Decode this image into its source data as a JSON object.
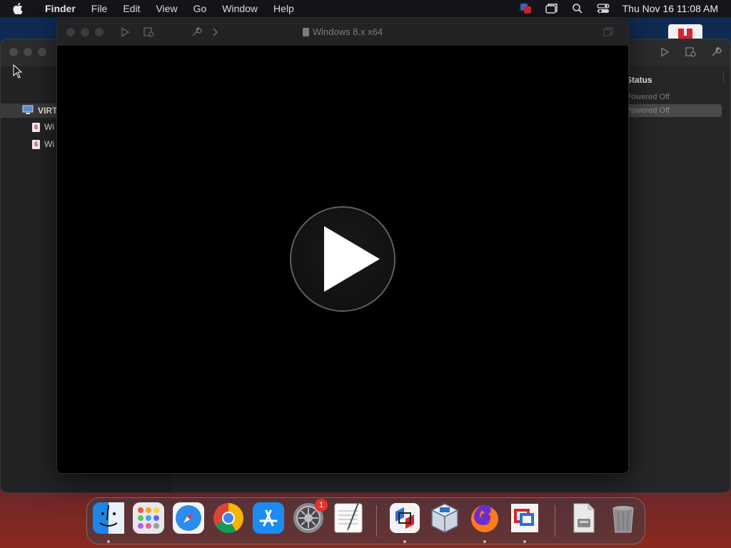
{
  "menubar": {
    "app_name": "Finder",
    "items": [
      "File",
      "Edit",
      "View",
      "Go",
      "Window",
      "Help"
    ],
    "clock": "Thu Nov 16  11:08 AM"
  },
  "bg_window": {
    "sidebar_header": "VIRTUAL MACHINES",
    "vm_items": [
      "Wi",
      "Wi"
    ],
    "status_header": "Status",
    "status_rows": [
      "Powered Off",
      "Powered Off"
    ]
  },
  "vm_window": {
    "title": "Windows 8.x x64"
  },
  "dock": {
    "system_settings_badge": "1"
  },
  "colors": {
    "menubar_bg": "#16161a",
    "window_bg": "#262628",
    "vm_screen_bg": "#000000",
    "badge": "#e5322d"
  }
}
